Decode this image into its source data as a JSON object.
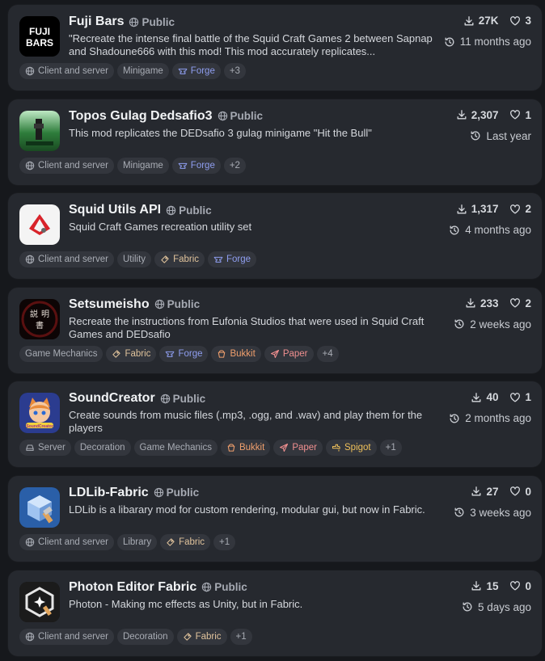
{
  "projects": [
    {
      "title": "Fuji Bars",
      "visibility": "Public",
      "icon": "fuji-bars-logo",
      "description": "\"Recreate the intense final battle of the Squid Craft Games 2 between Sapnap and Shadoune666 with this mod! This mod accurately replicates...",
      "downloads": "27K",
      "follows": "3",
      "updated": "11 months ago",
      "tags": [
        {
          "label": "Client and server",
          "icon": "globe-icon",
          "kind": "env"
        },
        {
          "label": "Minigame",
          "icon": "",
          "kind": "cat"
        },
        {
          "label": "Forge",
          "icon": "forge-icon",
          "kind": "forge"
        },
        {
          "label": "+3",
          "icon": "",
          "kind": "more"
        }
      ]
    },
    {
      "title": "Topos Gulag Dedsafio3",
      "visibility": "Public",
      "icon": "topos-gulag-logo",
      "description": "This mod replicates the DEDsafio 3 gulag minigame \"Hit the Bull\"",
      "downloads": "2,307",
      "follows": "1",
      "updated": "Last year",
      "tags": [
        {
          "label": "Client and server",
          "icon": "globe-icon",
          "kind": "env"
        },
        {
          "label": "Minigame",
          "icon": "",
          "kind": "cat"
        },
        {
          "label": "Forge",
          "icon": "forge-icon",
          "kind": "forge"
        },
        {
          "label": "+2",
          "icon": "",
          "kind": "more"
        }
      ]
    },
    {
      "title": "Squid Utils API",
      "visibility": "Public",
      "icon": "squid-utils-logo",
      "description": "Squid Craft Games recreation utility set",
      "downloads": "1,317",
      "follows": "2",
      "updated": "4 months ago",
      "tags": [
        {
          "label": "Client and server",
          "icon": "globe-icon",
          "kind": "env"
        },
        {
          "label": "Utility",
          "icon": "",
          "kind": "cat"
        },
        {
          "label": "Fabric",
          "icon": "fabric-icon",
          "kind": "fabric"
        },
        {
          "label": "Forge",
          "icon": "forge-icon",
          "kind": "forge"
        }
      ]
    },
    {
      "title": "Setsumeisho",
      "visibility": "Public",
      "icon": "setsumeisho-logo",
      "description": "Recreate the instructions from Eufonia Studios that were used in Squid Craft Games and DEDsafio",
      "downloads": "233",
      "follows": "2",
      "updated": "2 weeks ago",
      "tags": [
        {
          "label": "Game Mechanics",
          "icon": "",
          "kind": "cat"
        },
        {
          "label": "Fabric",
          "icon": "fabric-icon",
          "kind": "fabric"
        },
        {
          "label": "Forge",
          "icon": "forge-icon",
          "kind": "forge"
        },
        {
          "label": "Bukkit",
          "icon": "bukkit-icon",
          "kind": "bukkit"
        },
        {
          "label": "Paper",
          "icon": "paper-icon",
          "kind": "paper"
        },
        {
          "label": "+4",
          "icon": "",
          "kind": "more"
        }
      ]
    },
    {
      "title": "SoundCreator",
      "visibility": "Public",
      "icon": "soundcreator-logo",
      "description": "Create sounds from music files (.mp3, .ogg, and .wav) and play them for the players",
      "downloads": "40",
      "follows": "1",
      "updated": "2 months ago",
      "tags": [
        {
          "label": "Server",
          "icon": "server-icon",
          "kind": "env"
        },
        {
          "label": "Decoration",
          "icon": "",
          "kind": "cat"
        },
        {
          "label": "Game Mechanics",
          "icon": "",
          "kind": "cat"
        },
        {
          "label": "Bukkit",
          "icon": "bukkit-icon",
          "kind": "bukkit"
        },
        {
          "label": "Paper",
          "icon": "paper-icon",
          "kind": "paper"
        },
        {
          "label": "Spigot",
          "icon": "spigot-icon",
          "kind": "spigot"
        },
        {
          "label": "+1",
          "icon": "",
          "kind": "more"
        }
      ]
    },
    {
      "title": "LDLib-Fabric",
      "visibility": "Public",
      "icon": "ldlib-logo",
      "description": "LDLib is a libarary mod for custom rendering, modular gui, but now in Fabric.",
      "downloads": "27",
      "follows": "0",
      "updated": "3 weeks ago",
      "tags": [
        {
          "label": "Client and server",
          "icon": "globe-icon",
          "kind": "env"
        },
        {
          "label": "Library",
          "icon": "",
          "kind": "cat"
        },
        {
          "label": "Fabric",
          "icon": "fabric-icon",
          "kind": "fabric"
        },
        {
          "label": "+1",
          "icon": "",
          "kind": "more"
        }
      ]
    },
    {
      "title": "Photon Editor Fabric",
      "visibility": "Public",
      "icon": "photon-logo",
      "description": "Photon - Making mc effects as Unity, but in Fabric.",
      "downloads": "15",
      "follows": "0",
      "updated": "5 days ago",
      "tags": [
        {
          "label": "Client and server",
          "icon": "globe-icon",
          "kind": "env"
        },
        {
          "label": "Decoration",
          "icon": "",
          "kind": "cat"
        },
        {
          "label": "Fabric",
          "icon": "fabric-icon",
          "kind": "fabric"
        },
        {
          "label": "+1",
          "icon": "",
          "kind": "more"
        }
      ]
    }
  ]
}
